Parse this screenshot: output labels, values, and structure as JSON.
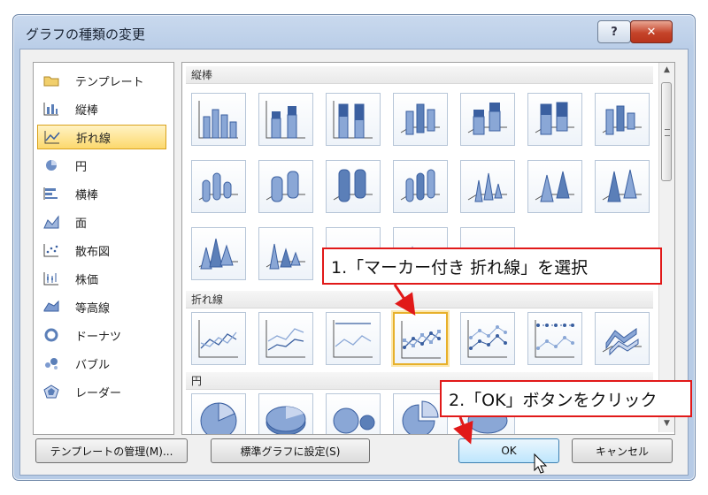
{
  "dialog": {
    "title": "グラフの種類の変更",
    "help_label": "?",
    "close_label": "✕"
  },
  "categories": [
    {
      "label": "テンプレート",
      "icon": "folder-icon"
    },
    {
      "label": "縦棒",
      "icon": "column-chart-icon"
    },
    {
      "label": "折れ線",
      "icon": "line-chart-icon",
      "selected": true
    },
    {
      "label": "円",
      "icon": "pie-chart-icon"
    },
    {
      "label": "横棒",
      "icon": "bar-chart-icon"
    },
    {
      "label": "面",
      "icon": "area-chart-icon"
    },
    {
      "label": "散布図",
      "icon": "scatter-chart-icon"
    },
    {
      "label": "株価",
      "icon": "stock-chart-icon"
    },
    {
      "label": "等高線",
      "icon": "surface-chart-icon"
    },
    {
      "label": "ドーナツ",
      "icon": "doughnut-chart-icon"
    },
    {
      "label": "バブル",
      "icon": "bubble-chart-icon"
    },
    {
      "label": "レーダー",
      "icon": "radar-chart-icon"
    }
  ],
  "sections": {
    "column": "縦棒",
    "line": "折れ線",
    "pie": "円"
  },
  "buttons": {
    "manage_templates": "テンプレートの管理(M)...",
    "set_default": "標準グラフに設定(S)",
    "ok": "OK",
    "cancel": "キャンセル"
  },
  "callouts": {
    "step1": "1.「マーカー付き 折れ線」を選択",
    "step2": "2.「OK」ボタンをクリック"
  },
  "colors": {
    "callout_border": "#e11919",
    "selection": "#e7b02a",
    "chart_blue": "#5b7fb8"
  }
}
